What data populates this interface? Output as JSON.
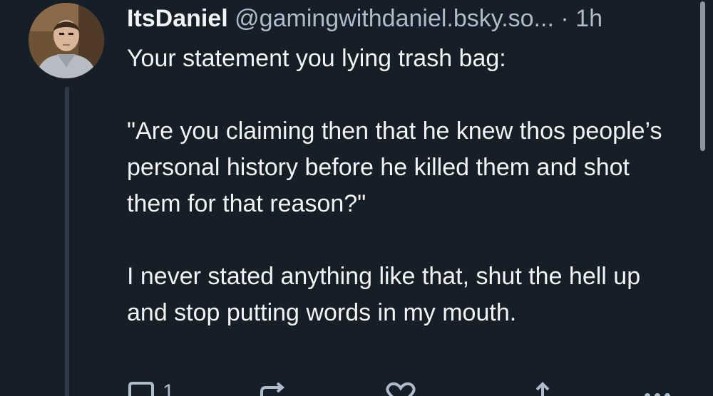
{
  "post": {
    "display_name": "ItsDaniel",
    "handle": "@gamingwithdaniel.bsky.so...",
    "separator": "·",
    "time": "1h",
    "paragraphs": [
      "Your statement you lying trash bag:",
      "\"Are you claiming then that he knew thos people’s personal history before he killed them and shot them for that reason?\"",
      "I never stated anything like that, shut the hell up and stop putting words in my mouth."
    ]
  },
  "actions": {
    "reply_count": "1",
    "icons": [
      "reply-icon",
      "repost-icon",
      "like-icon",
      "share-icon",
      "more-icon"
    ]
  },
  "colors": {
    "background": "#161e27",
    "text": "#f1f3f5",
    "muted": "#aebbc9",
    "thread_line": "#2e3a47"
  }
}
